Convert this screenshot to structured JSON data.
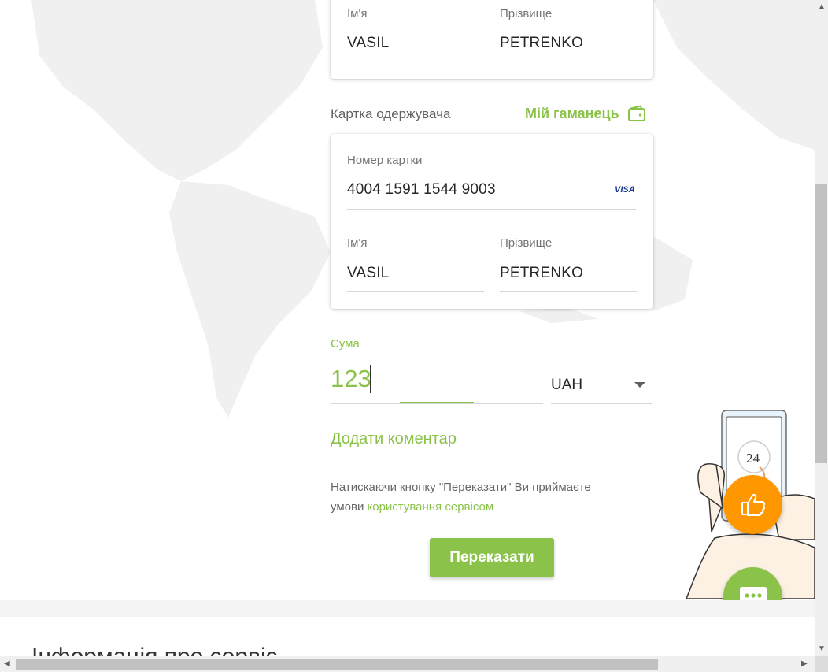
{
  "sender": {
    "first_name_label": "Ім'я",
    "first_name_value": "VASIL",
    "last_name_label": "Прізвище",
    "last_name_value": "PETRENKO"
  },
  "recipient": {
    "section_label": "Картка одержувача",
    "wallet_link": "Мій гаманець",
    "card_number_label": "Номер картки",
    "card_number_value": "4004 1591 1544 9003",
    "card_brand": "VISA",
    "first_name_label": "Ім'я",
    "first_name_value": "VASIL",
    "last_name_label": "Прізвище",
    "last_name_value": "PETRENKO"
  },
  "amount": {
    "label": "Сума",
    "value": "123",
    "currency": "UAH"
  },
  "comment_link": "Додати коментар",
  "terms": {
    "line1": "Натискаючи кнопку \"Переказати\" Ви приймаєте",
    "line2_prefix": "умови ",
    "link": "користування сервісом"
  },
  "submit_label": "Переказати",
  "promo_phone_text": "24",
  "footer_heading": "Інформація про сервіс",
  "colors": {
    "accent": "#8bc34a",
    "fab_orange": "#ff9800",
    "visa_blue": "#1a3b8f"
  },
  "icons": {
    "wallet": "wallet-icon",
    "dropdown": "caret-down-icon",
    "like": "thumbs-up-icon",
    "chat": "chat-icon"
  }
}
